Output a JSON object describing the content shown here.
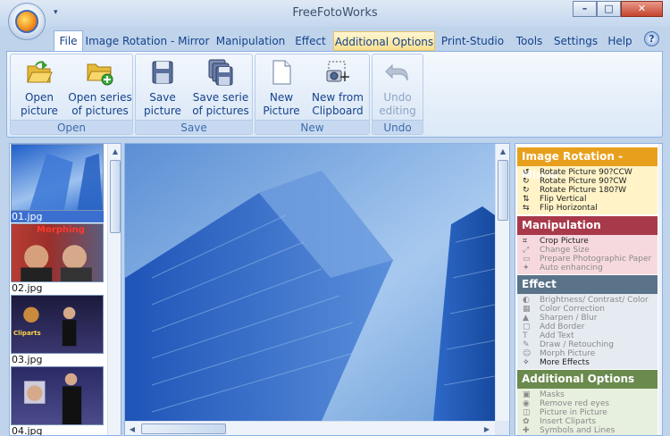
{
  "window": {
    "title": "FreeFotoWorks",
    "min_glyph": "–",
    "max_glyph": "□",
    "close_glyph": "✕",
    "qat_glyph": "▾"
  },
  "tabs": [
    "File",
    "Image Rotation - Mirror",
    "Manipulation",
    "Effect",
    "Additional Options",
    "Print-Studio",
    "Tools",
    "Settings",
    "Help"
  ],
  "help_glyph": "?",
  "ribbon": {
    "groups": [
      {
        "title": "Open",
        "buttons": [
          {
            "l1": "Open",
            "l2": "picture",
            "icon": "open-folder-icon"
          },
          {
            "l1": "Open series",
            "l2": "of pictures",
            "icon": "open-series-folder-icon"
          }
        ]
      },
      {
        "title": "Save",
        "buttons": [
          {
            "l1": "Save",
            "l2": "picture",
            "icon": "floppy-disk-icon"
          },
          {
            "l1": "Save serie",
            "l2": "of pictures",
            "icon": "floppy-stack-icon"
          }
        ]
      },
      {
        "title": "New",
        "buttons": [
          {
            "l1": "New",
            "l2": "Picture",
            "icon": "new-page-icon"
          },
          {
            "l1": "New from",
            "l2": "Clipboard",
            "icon": "clipboard-camera-icon"
          }
        ]
      },
      {
        "title": "Undo",
        "buttons": [
          {
            "l1": "Undo",
            "l2": "editing",
            "icon": "undo-arrow-icon"
          }
        ]
      }
    ]
  },
  "thumbnails": [
    {
      "label": "01.jpg",
      "selected": true
    },
    {
      "label": "02.jpg",
      "overlay": "Morphing"
    },
    {
      "label": "03.jpg",
      "overlay": "Cliparts"
    },
    {
      "label": "04.jpg"
    }
  ],
  "panel": {
    "sections": [
      {
        "title": "Image Rotation - Mirror",
        "color": "#e8a01c",
        "bg": "#fff3c7",
        "items": [
          {
            "label": "Rotate Picture 90?CCW",
            "dim": false
          },
          {
            "label": "Rotate Picture 90?CW",
            "dim": false
          },
          {
            "label": "Rotate Picture 180?W",
            "dim": false
          },
          {
            "label": "Flip Vertical",
            "dim": false
          },
          {
            "label": "Flip Horizontal",
            "dim": false
          }
        ]
      },
      {
        "title": "Manipulation",
        "color": "#a8394a",
        "bg": "#f6d9de",
        "items": [
          {
            "label": "Crop Picture",
            "dim": false
          },
          {
            "label": "Change Size",
            "dim": true
          },
          {
            "label": "Prepare Photographic Paper",
            "dim": true
          },
          {
            "label": "Auto enhancing",
            "dim": true
          }
        ]
      },
      {
        "title": "Effect",
        "color": "#5a7389",
        "bg": "#e5ebf1",
        "items": [
          {
            "label": "Brightness/ Contrast/ Color",
            "dim": true
          },
          {
            "label": "Color Correction",
            "dim": true
          },
          {
            "label": "Sharpen / Blur",
            "dim": true
          },
          {
            "label": "Add Border",
            "dim": true
          },
          {
            "label": "Add Text",
            "dim": true
          },
          {
            "label": "Draw / Retouching",
            "dim": true
          },
          {
            "label": "Morph Picture",
            "dim": true
          },
          {
            "label": "More Effects",
            "dim": false
          }
        ]
      },
      {
        "title": "Additional Options",
        "color": "#6b8a4e",
        "bg": "#e7efde",
        "items": [
          {
            "label": "Masks",
            "dim": true
          },
          {
            "label": "Remove red eyes",
            "dim": true
          },
          {
            "label": "Picture in Picture",
            "dim": true
          },
          {
            "label": "Insert Cliparts",
            "dim": true
          },
          {
            "label": "Symbols and Lines",
            "dim": true
          }
        ]
      }
    ]
  },
  "colors": {
    "ribbon_bg": "#dbe8f7",
    "frame": "#bfd3eb",
    "accent_text": "#15428b",
    "selection": "#3b6fcf"
  }
}
